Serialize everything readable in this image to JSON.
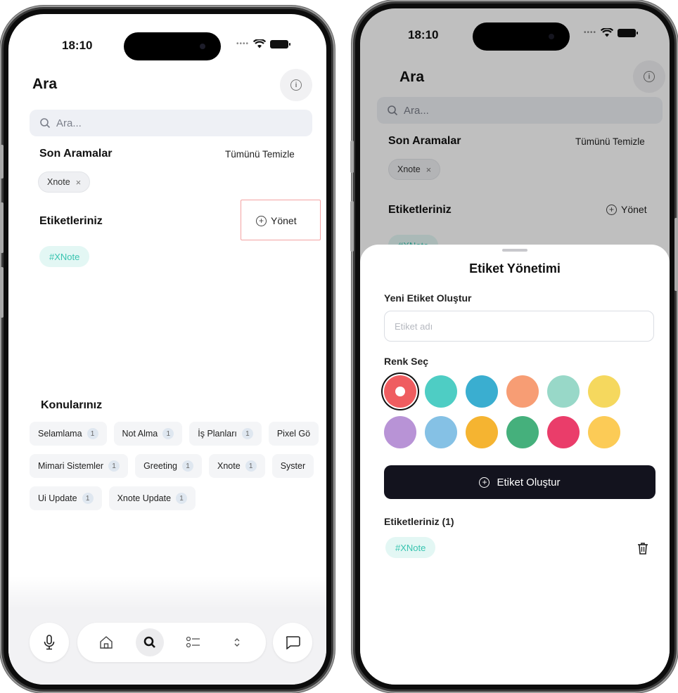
{
  "left_screen": {
    "status": {
      "time": "18:10"
    },
    "title": "Ara",
    "search": {
      "placeholder": "Ara..."
    },
    "recent": {
      "heading": "Son Aramalar",
      "clear_label": "Tümünü Temizle",
      "items": [
        {
          "label": "Xnote",
          "remove": "×"
        }
      ]
    },
    "tags": {
      "heading": "Etiketleriniz",
      "manage_label": "Yönet",
      "items": [
        {
          "label": "#XNote"
        }
      ]
    },
    "topics": {
      "heading": "Konularınız",
      "rows": [
        [
          {
            "label": "Selamlama",
            "count": "1"
          },
          {
            "label": "Not Alma",
            "count": "1"
          },
          {
            "label": "İş Planları",
            "count": "1"
          },
          {
            "label": "Pixel Gö",
            "count": ""
          }
        ],
        [
          {
            "label": "Mimari Sistemler",
            "count": "1"
          },
          {
            "label": "Greeting",
            "count": "1"
          },
          {
            "label": "Xnote",
            "count": "1"
          },
          {
            "label": "Syster",
            "count": ""
          }
        ],
        [
          {
            "label": "Ui Update",
            "count": "1"
          },
          {
            "label": "Xnote Update",
            "count": "1"
          }
        ]
      ]
    },
    "nav": {
      "items": [
        "microphone-icon",
        "home-icon",
        "search-icon",
        "checklist-icon",
        "chevron-updown-icon",
        "chat-icon"
      ],
      "active": "search-icon"
    }
  },
  "right_screen": {
    "status": {
      "time": "18:10"
    },
    "background": {
      "title": "Ara",
      "search_placeholder": "Ara...",
      "recent_heading": "Son Aramalar",
      "clear_label": "Tümünü Temizle",
      "recent_chip": "Xnote",
      "recent_chip_remove": "×",
      "tags_heading": "Etiketleriniz",
      "manage_label": "Yönet",
      "partial_tag": "#XNote"
    },
    "sheet": {
      "title": "Etiket Yönetimi",
      "new_label": "Yeni Etiket Oluştur",
      "input_placeholder": "Etiket adı",
      "color_label": "Renk Seç",
      "colors": [
        "#ef5d60",
        "#4ecdc4",
        "#3aaed0",
        "#f79d74",
        "#98d8c8",
        "#f5d85e",
        "#b893d6",
        "#85c1e5",
        "#f5b431",
        "#45b07c",
        "#ea3d6a",
        "#fccb56"
      ],
      "selected_color": "#ef5d60",
      "create_label": "Etiket Oluştur",
      "list_heading": "Etiketleriniz (1)",
      "list_items": [
        {
          "label": "#XNote"
        }
      ]
    }
  }
}
